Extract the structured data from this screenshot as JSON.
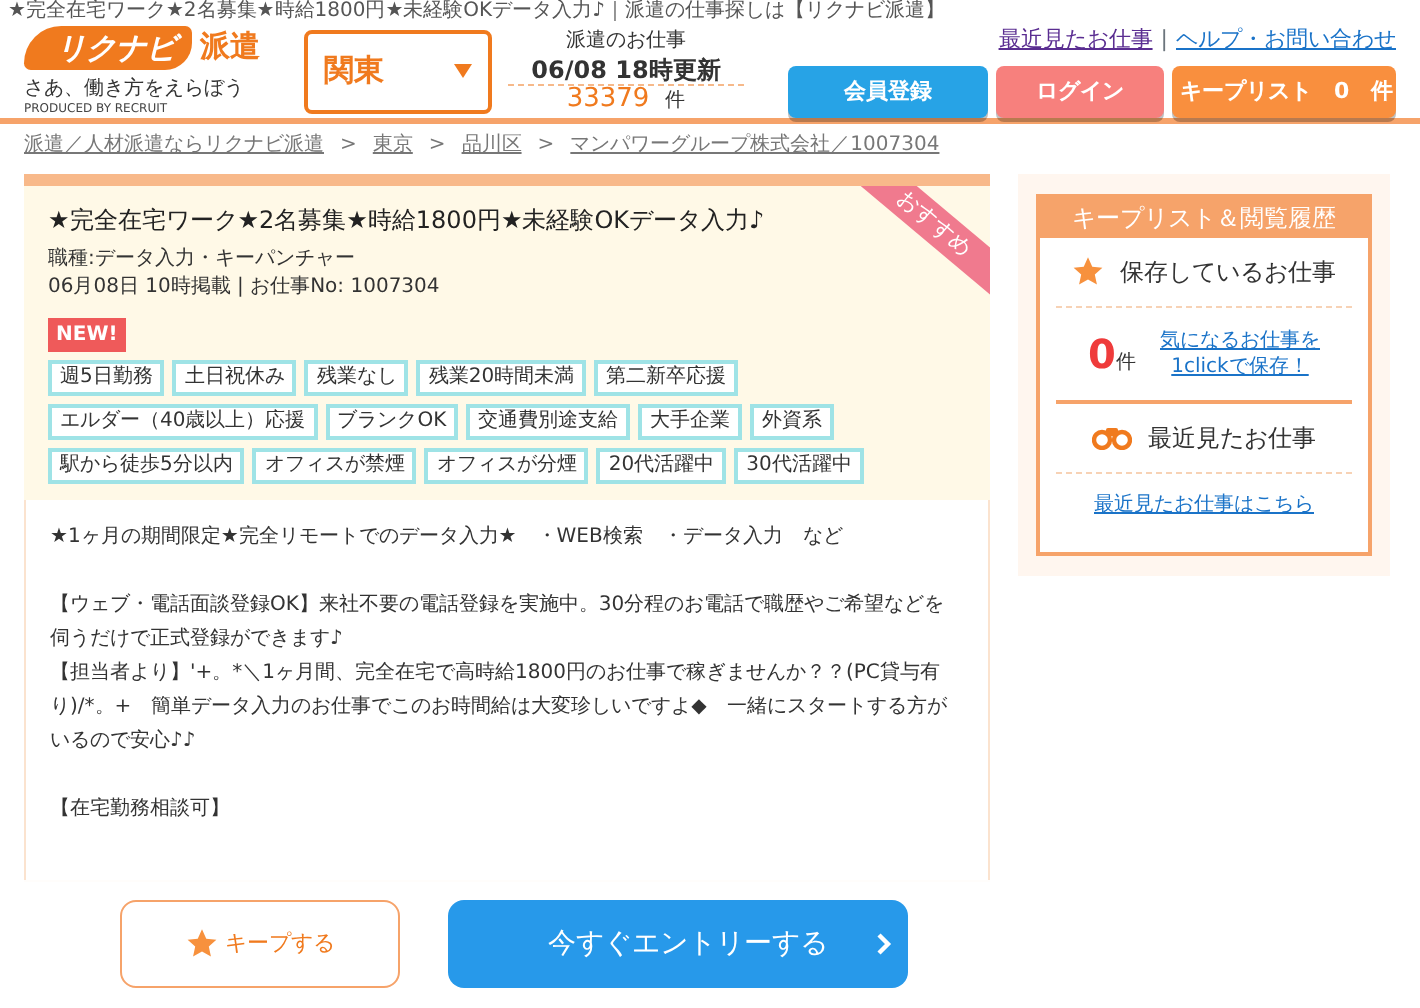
{
  "page_title": "★完全在宅ワーク★2名募集★時給1800円★未経験OKデータ入力♪｜派遣の仕事探しは【リクナビ派遣】",
  "logo": {
    "brand": "リクナビ",
    "suffix": "派遣",
    "tagline": "さあ、働き方をえらぼう",
    "produced_by": "PRODUCED BY RECRUIT"
  },
  "region_select": {
    "value": "関東"
  },
  "update_info": {
    "label": "派遣のお仕事",
    "updated": "06/08 18時更新",
    "count": "33379",
    "unit": "件"
  },
  "header_links": [
    {
      "label": "最近見たお仕事",
      "visited": true
    },
    {
      "label": "ヘルプ・お問い合わせ",
      "visited": false
    }
  ],
  "header_link_separator": "|",
  "breadcrumb_separator": ">",
  "header_buttons": [
    {
      "label": "会員登録",
      "kind": "register"
    },
    {
      "label": "ログイン",
      "kind": "login"
    },
    {
      "label": "キープリスト　0　件",
      "kind": "keeplist"
    }
  ],
  "breadcrumb": [
    "派遣／人材派遣ならリクナビ派遣",
    "東京",
    "品川区",
    "マンパワーグループ株式会社／1007304"
  ],
  "job": {
    "ribbon": "おすすめ",
    "title": "★完全在宅ワーク★2名募集★時給1800円★未経験OKデータ入力♪",
    "category": "職種:データ入力・キーパンチャー",
    "posted": "06月08日 10時掲載 | お仕事No: 1007304",
    "badge": "NEW!",
    "tags": [
      "週5日勤務",
      "土日祝休み",
      "残業なし",
      "残業20時間未満",
      "第二新卒応援",
      "エルダー（40歳以上）応援",
      "ブランクOK",
      "交通費別途支給",
      "大手企業",
      "外資系",
      "駅から徒歩5分以内",
      "オフィスが禁煙",
      "オフィスが分煙",
      "20代活躍中",
      "30代活躍中"
    ],
    "description": [
      "★1ヶ月の期間限定★完全リモートでのデータ入力★　・WEB検索　・データ入力　など",
      "【ウェブ・電話面談登録OK】来社不要の電話登録を実施中。30分程のお電話で職歴やご希望などを伺うだけで正式登録ができます♪\n【担当者より】'+。*＼1ヶ月間、完全在宅で高時給1800円のお仕事で稼ぎませんか？？(PC貸与有り)/*。+　簡単データ入力のお仕事でこのお時間給は大変珍しいですよ◆　一緒にスタートする方がいるので安心♪♪",
      "【在宅勤務相談可】"
    ]
  },
  "sidebar": {
    "title": "キープリスト＆閲覧履歴",
    "saved": {
      "heading": "保存しているお仕事",
      "count": "0",
      "unit": "件",
      "link_lines": [
        "気になるお仕事を",
        "1clickで保存！"
      ]
    },
    "recent": {
      "heading": "最近見たお仕事",
      "link": "最近見たお仕事はこちら"
    }
  },
  "action_bar": {
    "keep_button": "キープする",
    "entry_button": "今すぐエントリーする"
  }
}
